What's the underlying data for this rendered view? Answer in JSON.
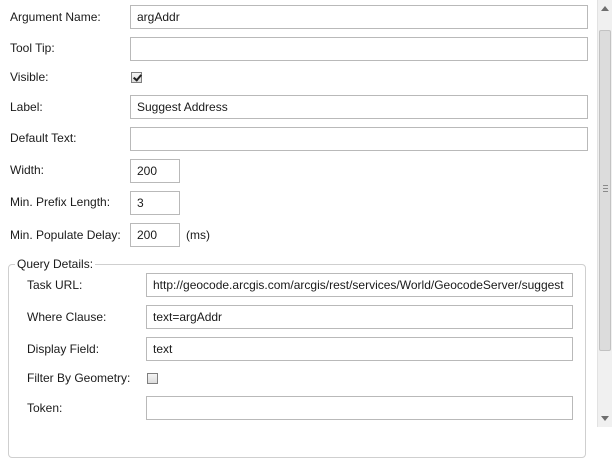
{
  "fields": {
    "argument_name": {
      "label": "Argument Name:",
      "value": "argAddr"
    },
    "tool_tip": {
      "label": "Tool Tip:",
      "value": ""
    },
    "visible": {
      "label": "Visible:"
    },
    "label": {
      "label": "Label:",
      "value": "Suggest Address"
    },
    "default_text": {
      "label": "Default Text:",
      "value": ""
    },
    "width": {
      "label": "Width:",
      "value": "200"
    },
    "min_prefix_length": {
      "label": "Min. Prefix Length:",
      "value": "3"
    },
    "min_populate_delay": {
      "label": "Min. Populate Delay:",
      "value": "200",
      "unit": "(ms)"
    }
  },
  "query_details": {
    "legend": "Query Details:",
    "task_url": {
      "label": "Task URL:",
      "value": "http://geocode.arcgis.com/arcgis/rest/services/World/GeocodeServer/suggest"
    },
    "where_clause": {
      "label": "Where Clause:",
      "value": "text=argAddr"
    },
    "display_field": {
      "label": "Display Field:",
      "value": "text"
    },
    "filter_by_geometry": {
      "label": "Filter By Geometry:"
    },
    "token": {
      "label": "Token:",
      "value": ""
    }
  },
  "icons": {
    "scroll_up": "arrow-up-icon",
    "scroll_down": "arrow-down-icon"
  }
}
